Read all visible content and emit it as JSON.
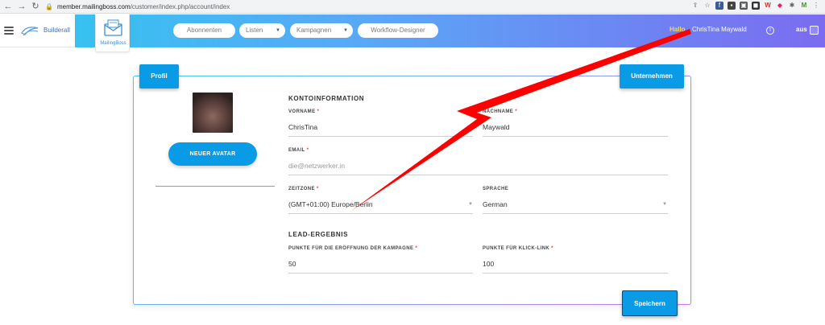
{
  "browser": {
    "url_domain": "member.mailingboss.com",
    "url_path": "/customer/index.php/account/index"
  },
  "header": {
    "logo_text": "Builderall",
    "product_label": "MailingBoss",
    "nav": [
      {
        "label": "Abonnenten"
      },
      {
        "label": "Listen"
      },
      {
        "label": "Kampagnen"
      },
      {
        "label": "Workflow-Designer"
      }
    ],
    "greeting": "Hallo,",
    "user_name": "ChrisTina Maywald",
    "logout_label": "aus"
  },
  "card": {
    "tab_profile": "Profil",
    "tab_company": "Unternehmen",
    "avatar_button": "NEUER AVATAR",
    "section_account": "KONTOINFORMATION",
    "section_lead": "LEAD-ERGEBNIS",
    "fields": {
      "first_name": {
        "label": "VORNAME",
        "required": "*",
        "value": "ChrisTina"
      },
      "last_name": {
        "label": "NACHNAME",
        "required": "*",
        "value": "Maywald"
      },
      "email": {
        "label": "EMAIL",
        "required": "*",
        "value": "die@netzwerker.in"
      },
      "timezone": {
        "label": "ZEITZONE",
        "required": "*",
        "value": "(GMT+01:00) Europe/Berlin"
      },
      "language": {
        "label": "SPRACHE",
        "value": "German"
      },
      "points_open": {
        "label": "PUNKTE FÜR DIE ERÖFFNUNG DER KAMPAGNE",
        "required": "*",
        "value": "50"
      },
      "points_click": {
        "label": "PUNKTE FÜR KLICK-LINK",
        "required": "*",
        "value": "100"
      }
    },
    "save_button": "Speichern"
  },
  "colors": {
    "primary": "#0a9be6",
    "required": "#e53935",
    "annotation_arrow": "#ff0000"
  }
}
